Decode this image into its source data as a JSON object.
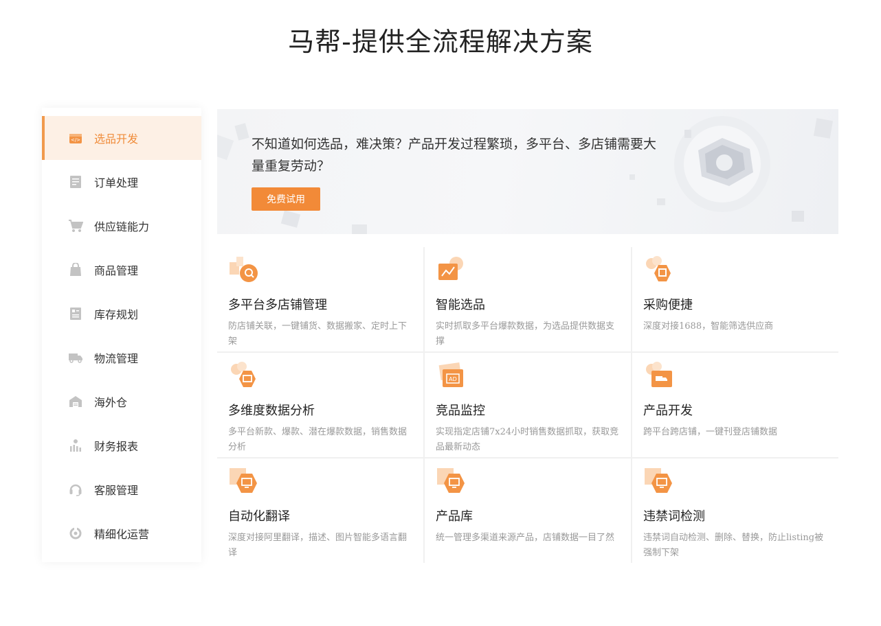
{
  "page": {
    "title": "马帮-提供全流程解决方案"
  },
  "sidebar": {
    "items": [
      {
        "label": "选品开发",
        "icon": "code-box-icon",
        "active": true
      },
      {
        "label": "订单处理",
        "icon": "document-icon"
      },
      {
        "label": "供应链能力",
        "icon": "cart-icon"
      },
      {
        "label": "商品管理",
        "icon": "shopping-bag-icon"
      },
      {
        "label": "库存规划",
        "icon": "inventory-icon"
      },
      {
        "label": "物流管理",
        "icon": "truck-icon"
      },
      {
        "label": "海外仓",
        "icon": "warehouse-icon"
      },
      {
        "label": "财务报表",
        "icon": "finance-chart-icon"
      },
      {
        "label": "客服管理",
        "icon": "headset-icon"
      },
      {
        "label": "精细化运营",
        "icon": "operations-icon"
      }
    ]
  },
  "banner": {
    "text": "不知道如何选品，难决策？产品开发过程繁琐，多平台、多店铺需要大量重复劳动？",
    "button_label": "免费试用"
  },
  "features": [
    {
      "title": "多平台多店铺管理",
      "desc": "防店铺关联，一键铺货、数据搬家、定时上下架",
      "icon": "search-store-icon"
    },
    {
      "title": "智能选品",
      "desc": "实时抓取多平台爆款数据，为选品提供数据支撑",
      "icon": "trend-chart-icon"
    },
    {
      "title": "采购便捷",
      "desc": "深度对接1688，智能筛选供应商",
      "icon": "purchase-icon"
    },
    {
      "title": "多维度数据分析",
      "desc": "多平台新款、爆款、潜在爆款数据，销售数据分析",
      "icon": "data-analysis-icon"
    },
    {
      "title": "竞品监控",
      "desc": "实现指定店铺7x24小时销售数据抓取，获取竞品最新动态",
      "icon": "ad-icon"
    },
    {
      "title": "产品开发",
      "desc": "跨平台跨店铺，一键刊登店铺数据",
      "icon": "delivery-icon"
    },
    {
      "title": "自动化翻译",
      "desc": "深度对接阿里翻译，描述、图片智能多语言翻译",
      "icon": "monitor-icon"
    },
    {
      "title": "产品库",
      "desc": "统一管理多渠道来源产品，店铺数据一目了然",
      "icon": "monitor-icon"
    },
    {
      "title": "违禁词检测",
      "desc": "违禁词自动检测、删除、替换，防止listing被强制下架",
      "icon": "monitor-icon"
    }
  ],
  "colors": {
    "accent": "#f28a38",
    "active_bg": "#fdf0e5",
    "icon_gray": "#c3c3c3"
  }
}
